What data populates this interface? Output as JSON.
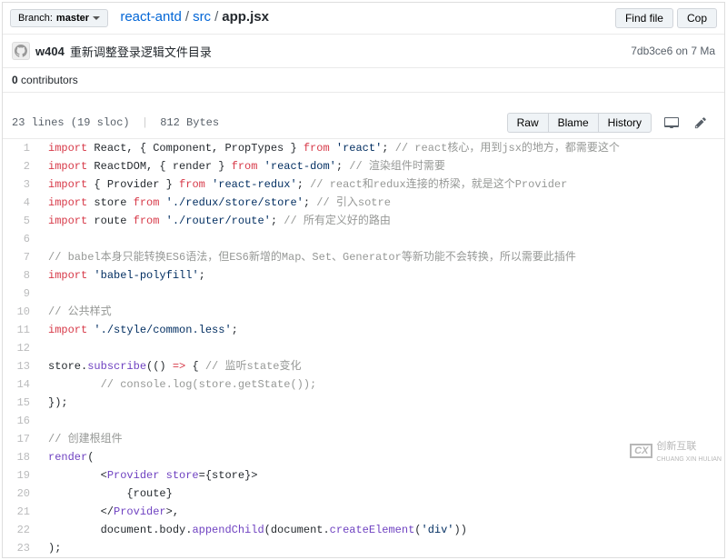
{
  "branch": {
    "label": "Branch:",
    "name": "master"
  },
  "breadcrumb": {
    "repo": "react-antd",
    "folder": "src",
    "file": "app.jsx"
  },
  "header_buttons": {
    "find_file": "Find file",
    "copy": "Cop"
  },
  "commit": {
    "user": "w404",
    "message": "重新调整登录逻辑文件目录",
    "sha": "7db3ce6",
    "date_prefix": "on",
    "date": "7 Ma"
  },
  "contributors": {
    "count": "0",
    "label": "contributors"
  },
  "file_info": {
    "lines": "23 lines (19 sloc)",
    "size": "812 Bytes"
  },
  "toolbar_buttons": {
    "raw": "Raw",
    "blame": "Blame",
    "history": "History"
  },
  "code": [
    {
      "n": 1,
      "html": "<span class='pl-k'>import</span> React, { Component, PropTypes } <span class='pl-k'>from</span> <span class='pl-s'>'react'</span>; <span class='pl-c'>// react核心，用到jsx的地方，都需要这个</span>"
    },
    {
      "n": 2,
      "html": "<span class='pl-k'>import</span> ReactDOM, { render } <span class='pl-k'>from</span> <span class='pl-s'>'react-dom'</span>; <span class='pl-c'>// 渲染组件时需要</span>"
    },
    {
      "n": 3,
      "html": "<span class='pl-k'>import</span> { Provider } <span class='pl-k'>from</span> <span class='pl-s'>'react-redux'</span>; <span class='pl-c'>// react和redux连接的桥梁，就是这个Provider</span>"
    },
    {
      "n": 4,
      "html": "<span class='pl-k'>import</span> store <span class='pl-k'>from</span> <span class='pl-s'>'./redux/store/store'</span>; <span class='pl-c'>// 引入sotre</span>"
    },
    {
      "n": 5,
      "html": "<span class='pl-k'>import</span> route <span class='pl-k'>from</span> <span class='pl-s'>'./router/route'</span>; <span class='pl-c'>// 所有定义好的路由</span>"
    },
    {
      "n": 6,
      "html": ""
    },
    {
      "n": 7,
      "html": "<span class='pl-c'>// babel本身只能转换ES6语法，但ES6新增的Map、Set、Generator等新功能不会转换，所以需要此插件</span>"
    },
    {
      "n": 8,
      "html": "<span class='pl-k'>import</span> <span class='pl-s'>'babel-polyfill'</span>;"
    },
    {
      "n": 9,
      "html": ""
    },
    {
      "n": 10,
      "html": "<span class='pl-c'>// 公共样式</span>"
    },
    {
      "n": 11,
      "html": "<span class='pl-k'>import</span> <span class='pl-s'>'./style/common.less'</span>;"
    },
    {
      "n": 12,
      "html": ""
    },
    {
      "n": 13,
      "html": "store.<span class='pl-en'>subscribe</span>(() <span class='pl-k'>=&gt;</span> { <span class='pl-c'>// 监听state变化</span>"
    },
    {
      "n": 14,
      "html": "        <span class='pl-c'>// console.log(store.getState());</span>"
    },
    {
      "n": 15,
      "html": "});"
    },
    {
      "n": 16,
      "html": ""
    },
    {
      "n": 17,
      "html": "<span class='pl-c'>// 创建根组件</span>"
    },
    {
      "n": 18,
      "html": "<span class='pl-en'>render</span>("
    },
    {
      "n": 19,
      "html": "        &lt;<span class='pl-en'>Provider</span> <span class='pl-en'>store</span>={store}&gt;"
    },
    {
      "n": 20,
      "html": "            {route}"
    },
    {
      "n": 21,
      "html": "        &lt;/<span class='pl-en'>Provider</span>&gt;,"
    },
    {
      "n": 22,
      "html": "        document.body.<span class='pl-en'>appendChild</span>(document.<span class='pl-en'>createElement</span>(<span class='pl-s'>'div'</span>))"
    },
    {
      "n": 23,
      "html": ");"
    }
  ],
  "watermark": {
    "brand": "创新互联",
    "sub": "CHUANG XIN HULIAN"
  }
}
